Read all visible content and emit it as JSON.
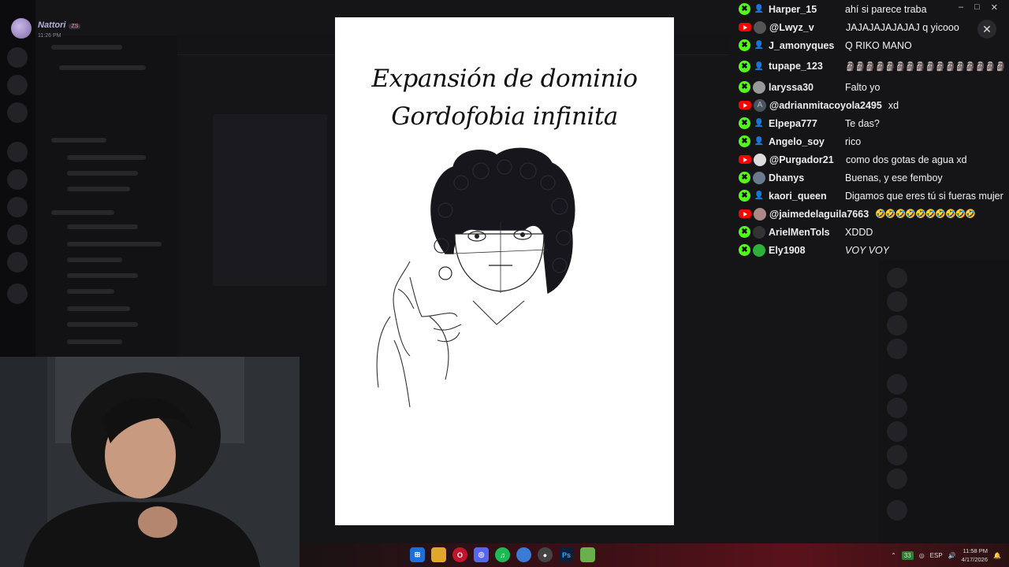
{
  "notification": {
    "name": "Nattori",
    "badge": "ZS",
    "time": "11:26 PM"
  },
  "canvas": {
    "title_line1": "Expansión de dominio",
    "title_line2": "Gordofobia infinita"
  },
  "window_controls": {
    "minimize": "–",
    "maximize": "□",
    "close": "✕"
  },
  "overlay_close": "✕",
  "chat": [
    {
      "platform": "kick",
      "avatar": "person-icon",
      "user": "Harper_15",
      "message": "ahí si parece traba"
    },
    {
      "platform": "youtube",
      "avatar": "avatar",
      "user": "@Lwyz_v",
      "message": "JAJAJAJAJAJAJ q yicooo"
    },
    {
      "platform": "kick",
      "avatar": "person-icon",
      "user": "J_amonyques",
      "message": "Q RIKO MANO"
    },
    {
      "platform": "kick",
      "avatar": "person-icon",
      "user": "tupape_123",
      "message": "🗿🗿🗿🗿🗿🗿🗿🗿🗿🗿🗿🗿🗿🗿🗿🗿"
    },
    {
      "platform": "kick",
      "avatar": "avatar",
      "user": "laryssa30",
      "message": "Falto yo"
    },
    {
      "platform": "youtube",
      "avatar": "A",
      "user": "@adrianmitacoyola2495",
      "message": "xd"
    },
    {
      "platform": "kick",
      "avatar": "person-icon",
      "user": "Elpepa777",
      "message": "Te das?"
    },
    {
      "platform": "kick",
      "avatar": "person-icon",
      "user": "Angelo_soy",
      "message": "rico"
    },
    {
      "platform": "youtube",
      "avatar": "avatar",
      "user": "@Purgador21",
      "message": "como dos gotas de agua xd"
    },
    {
      "platform": "kick",
      "avatar": "avatar",
      "user": "Dhanys",
      "message": "Buenas, y ese femboy"
    },
    {
      "platform": "kick",
      "avatar": "person-icon",
      "user": "kaori_queen",
      "message": "Digamos que eres tú si fueras mujer"
    },
    {
      "platform": "youtube",
      "avatar": "avatar",
      "user": "@jaimedelaguila7663",
      "message": "🤣🤣🤣🤣🤣🤣🤣🤣🤣🤣"
    },
    {
      "platform": "kick",
      "avatar": "avatar",
      "user": "ArielMenTols",
      "message": "XDDD"
    },
    {
      "platform": "kick",
      "avatar": "avatar",
      "user": "Ely1908",
      "message": "VOY VOY"
    }
  ],
  "taskbar": {
    "apps": [
      "windows-start-icon",
      "file-explorer-icon",
      "opera-icon",
      "discord-icon",
      "spotify-icon",
      "browser-icon",
      "obs-icon",
      "photoshop-icon",
      "app-icon"
    ],
    "ps_label": "Ps",
    "tray_badge": "33",
    "language": "ESP",
    "time": "11:58 PM",
    "date": "4/17/2026"
  }
}
